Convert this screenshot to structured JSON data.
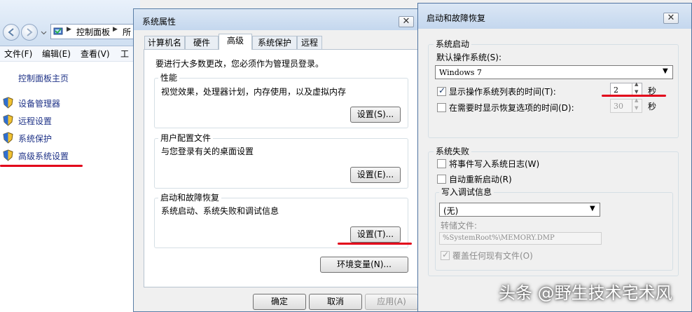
{
  "control_panel": {
    "address_root": "控制面板",
    "address_next": "所",
    "menu": [
      "文件(F)",
      "编辑(E)",
      "查看(V)",
      "工"
    ],
    "home_link": "控制面板主页",
    "links": [
      "设备管理器",
      "远程设置",
      "系统保护",
      "高级系统设置"
    ]
  },
  "sys_props": {
    "title": "系统属性",
    "close": "✕",
    "tabs": [
      "计算机名",
      "硬件",
      "高级",
      "系统保护",
      "远程"
    ],
    "admin_note": "要进行大多数更改，您必须作为管理员登录。",
    "performance": {
      "legend": "性能",
      "desc": "视觉效果，处理器计划，内存使用，以及虚拟内存",
      "button": "设置(S)..."
    },
    "user_profiles": {
      "legend": "用户配置文件",
      "desc": "与您登录有关的桌面设置",
      "button": "设置(E)..."
    },
    "startup_recovery": {
      "legend": "启动和故障恢复",
      "desc": "系统启动、系统失败和调试信息",
      "button": "设置(T)..."
    },
    "env_button": "环境变量(N)...",
    "ok": "确定",
    "cancel": "取消",
    "apply": "应用(A)"
  },
  "startup_dialog": {
    "title": "启动和故障恢复",
    "close": "✕",
    "system_startup": {
      "legend": "系统启动",
      "default_os_label": "默认操作系统(S):",
      "default_os_value": "Windows 7",
      "show_list_label": "显示操作系统列表的时间(T):",
      "show_list_checked": true,
      "show_list_value": "2",
      "show_recovery_label": "在需要时显示恢复选项的时间(D):",
      "show_recovery_checked": false,
      "show_recovery_value": "30",
      "seconds": "秒"
    },
    "system_failure": {
      "legend": "系统失败",
      "write_event_label": "将事件写入系统日志(W)",
      "auto_restart_label": "自动重新启动(R)",
      "debug_info_legend": "写入调试信息",
      "debug_value": "(无)",
      "dump_file_label": "转储文件:",
      "dump_file_value": "%SystemRoot%\\MEMORY.DMP",
      "overwrite_label": "覆盖任何现有文件(O)"
    }
  },
  "watermark": "头条 @野生技术宅术风"
}
